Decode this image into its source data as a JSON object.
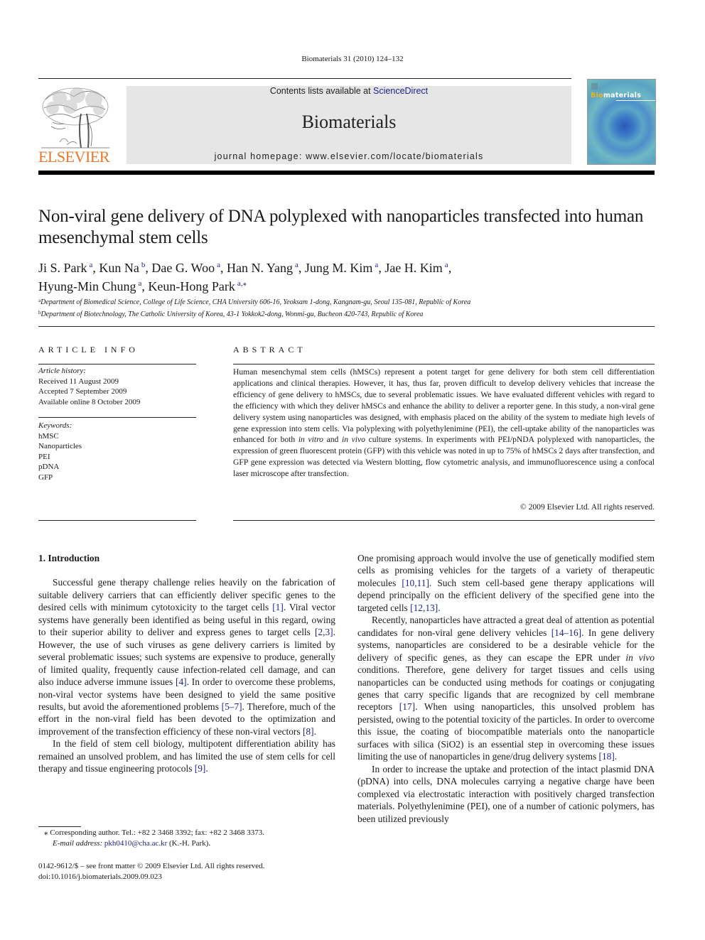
{
  "running_header": "Biomaterials 31 (2010) 124–132",
  "masthead": {
    "publisher_logo_text": "ELSEVIER",
    "contents_prefix": "Contents lists available at ",
    "contents_link": "ScienceDirect",
    "journal_name": "Biomaterials",
    "homepage_line": "journal homepage: www.elsevier.com/locate/biomaterials",
    "cover_brand_prefix": "Bio",
    "cover_brand_suffix": "materials",
    "colors": {
      "elsevier_orange": "#e8772c",
      "link_blue": "#1f1f8f",
      "box_gray": "#e6e6e6"
    }
  },
  "article": {
    "title": "Non-viral gene delivery of DNA polyplexed with nanoparticles transfected into human mesenchymal stem cells",
    "authors": [
      {
        "name": "Ji S. Park",
        "aff": "a",
        "sep": ", "
      },
      {
        "name": "Kun Na",
        "aff": "b",
        "sep": ", "
      },
      {
        "name": "Dae G. Woo",
        "aff": "a",
        "sep": ", "
      },
      {
        "name": "Han N. Yang",
        "aff": "a",
        "sep": ", "
      },
      {
        "name": "Jung M. Kim",
        "aff": "a",
        "sep": ", "
      },
      {
        "name": "Jae H. Kim",
        "aff": "a",
        "sep": ","
      },
      {
        "name": "Hyung-Min Chung",
        "aff": "a",
        "sep": ", "
      },
      {
        "name": "Keun-Hong Park",
        "aff": "a,⁎",
        "sep": ""
      }
    ],
    "affiliations": [
      {
        "mark": "a",
        "text": "Department of Biomedical Science, College of Life Science, CHA University 606-16, Yeoksam 1-dong, Kangnam-gu, Seoul 135-081, Republic of Korea"
      },
      {
        "mark": "b",
        "text": "Department of Biotechnology, The Catholic University of Korea, 43-1 Yokkok2-dong, Wonmi-gu, Bucheon 420-743, Republic of Korea"
      }
    ]
  },
  "article_info": {
    "heading": "ARTICLE INFO",
    "history_label": "Article history:",
    "history": [
      "Received 11 August 2009",
      "Accepted 7 September 2009",
      "Available online 8 October 2009"
    ],
    "keywords_label": "Keywords:",
    "keywords": [
      "hMSC",
      "Nanoparticles",
      "PEI",
      "pDNA",
      "GFP"
    ]
  },
  "abstract": {
    "heading": "ABSTRACT",
    "text_1": "Human mesenchymal stem cells (hMSCs) represent a potent target for gene delivery for both stem cell differentiation applications and clinical therapies. However, it has, thus far, proven difficult to develop delivery vehicles that increase the efficiency of gene delivery to hMSCs, due to several problematic issues. We have evaluated different vehicles with regard to the efficiency with which they deliver hMSCs and enhance the ability to deliver a reporter gene. In this study, a non-viral gene delivery system using nanoparticles was designed, with emphasis placed on the ability of the system to mediate high levels of gene expression into stem cells. Via polyplexing with polyethylenimine (PEI), the cell-uptake ability of the nanoparticles was enhanced for both ",
    "italic_1": "in vitro",
    "text_2": " and ",
    "italic_2": "in vivo",
    "text_3": " culture systems. In experiments with PEI/pNDA polyplexed with nanoparticles, the expression of green fluorescent protein (GFP) with this vehicle was noted in up to 75% of hMSCs 2 days after transfection, and GFP gene expression was detected via Western blotting, flow cytometric analysis, and immunofluorescence using a confocal laser microscope after transfection.",
    "copyright": "© 2009 Elsevier Ltd. All rights reserved."
  },
  "introduction": {
    "heading": "1.  Introduction",
    "p1": {
      "a": "Successful gene therapy challenge relies heavily on the fabrication of suitable delivery carriers that can efficiently deliver specific genes to the desired cells with minimum cytotoxicity to the target cells ",
      "c1": "[1]",
      "b": ". Viral vector systems have generally been identified as being useful in this regard, owing to their superior ability to deliver and express genes to target cells ",
      "c2": "[2,3]",
      "c": ". However, the use of such viruses as gene delivery carriers is limited by several problematic issues; such systems are expensive to produce, generally of limited quality, frequently cause infection-related cell damage, and can also induce adverse immune issues ",
      "c3": "[4]",
      "d": ". In order to overcome these problems, non-viral vector systems have been designed to yield the same positive results, but avoid the aforementioned problems ",
      "c4": "[5–7]",
      "e": ". Therefore, much of the effort in the non-viral field has been devoted to the optimization and improvement of the transfection efficiency of these non-viral vectors ",
      "c5": "[8]",
      "f": "."
    },
    "p2": {
      "a": "In the field of stem cell biology, multipotent differentiation ability has remained an unsolved problem, and has limited the use of stem cells for cell therapy and tissue engineering protocols ",
      "c1": "[9]",
      "b": "."
    },
    "p2_cont": {
      "a": "One promising approach would involve the use of genetically modified stem cells as promising vehicles for the targets of a variety of therapeutic molecules ",
      "c1": "[10,11]",
      "b": ". Such stem cell-based gene therapy applications will depend principally on the efficient delivery of the specified gene into the targeted cells ",
      "c2": "[12,13]",
      "c": "."
    },
    "p3": {
      "a": "Recently, nanoparticles have attracted a great deal of attention as potential candidates for non-viral gene delivery vehicles ",
      "c1": "[14–16]",
      "b": ". In gene delivery systems, nanoparticles are considered to be a desirable vehicle for the delivery of specific genes, as they can escape the EPR under ",
      "i1": "in vivo",
      "c": " conditions. Therefore, gene delivery for target tissues and cells using nanoparticles can be conducted using methods for coatings or conjugating genes that carry specific ligands that are recognized by cell membrane receptors ",
      "c2": "[17]",
      "d": ". When using nanoparticles, this unsolved problem has persisted, owing to the potential toxicity of the particles. In order to overcome this issue, the coating of biocompatible materials onto the nanoparticle surfaces with silica (SiO2) is an essential step in overcoming these issues limiting the use of nanoparticles in gene/drug delivery systems ",
      "c3": "[18]",
      "e": "."
    },
    "p4": {
      "a": "In order to increase the uptake and protection of the intact plasmid DNA (pDNA) into cells, DNA molecules carrying a negative charge have been complexed via electrostatic interaction with positively charged transfection materials. Polyethylenimine (PEI), one of a number of cationic polymers, has been utilized previously"
    }
  },
  "footnotes": {
    "corresponding": "⁎  Corresponding author. Tel.: +82 2 3468 3392; fax: +82 2 3468 3373.",
    "email_label": "E-mail address:",
    "email": "pkh0410@cha.ac.kr",
    "email_suffix": " (K.-H. Park).",
    "front_matter": "0142-9612/$ – see front matter © 2009 Elsevier Ltd. All rights reserved.",
    "doi": "doi:10.1016/j.biomaterials.2009.09.023"
  }
}
